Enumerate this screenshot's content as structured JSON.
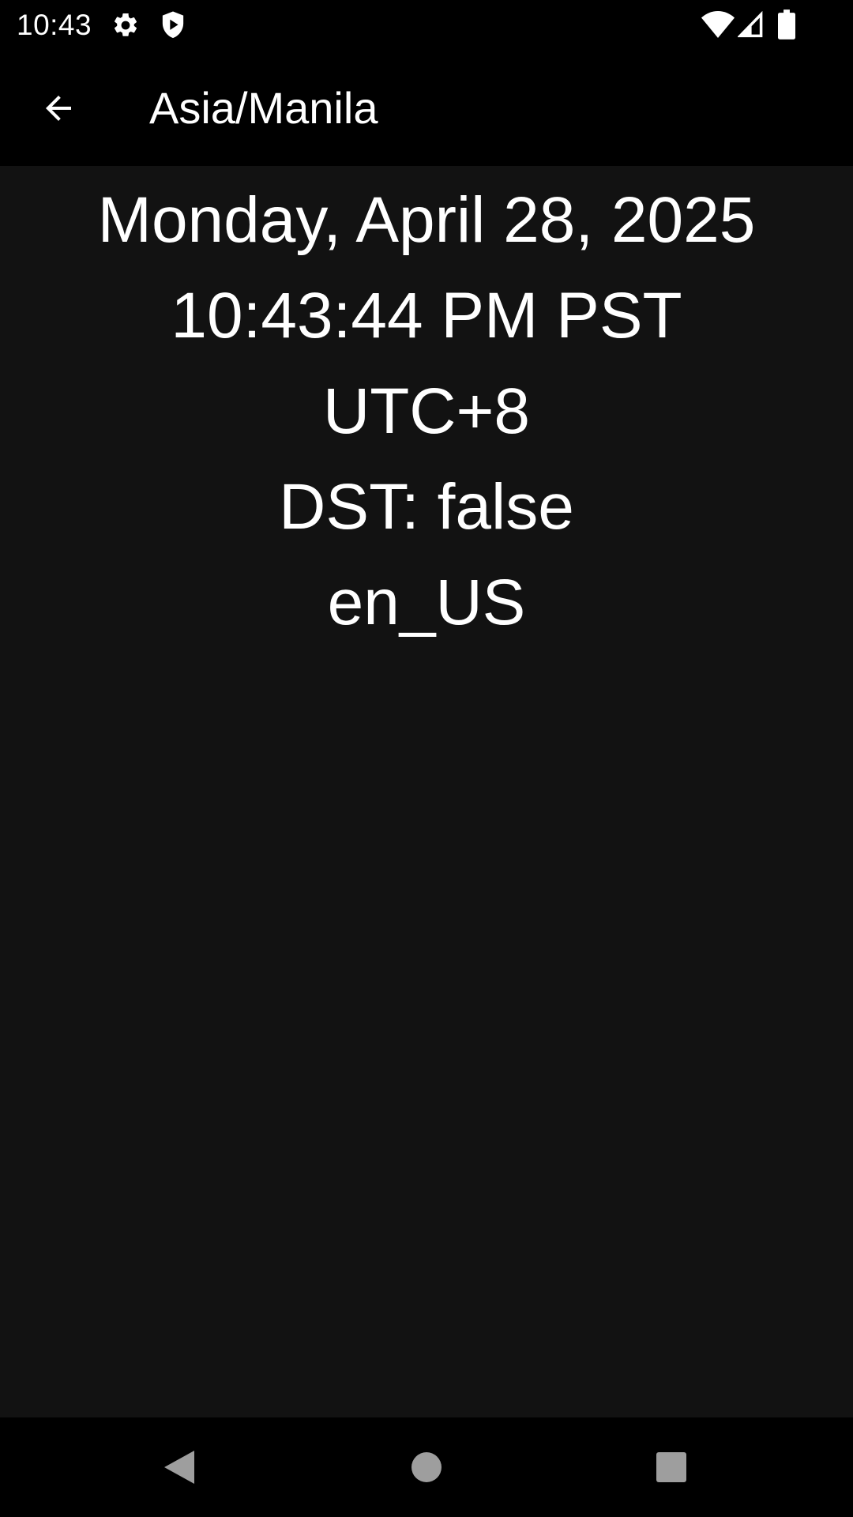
{
  "status_bar": {
    "time": "10:43",
    "left_icons": [
      "gear-icon",
      "shield-play-icon"
    ],
    "right_icons": [
      "wifi-icon",
      "cell-signal-icon",
      "battery-icon"
    ]
  },
  "app_bar": {
    "title": "Asia/Manila",
    "back_icon": "arrow-left-icon"
  },
  "details": {
    "date": "Monday, April 28, 2025",
    "time": "10:43:44 PM PST",
    "utc_offset": "UTC+8",
    "dst": "DST: false",
    "locale": "en_US"
  },
  "nav_bar": {
    "buttons": [
      "back-triangle-icon",
      "home-circle-icon",
      "recents-square-icon"
    ]
  },
  "colors": {
    "background": "#121212",
    "bars": "#000000",
    "text": "#ffffff",
    "nav_icon": "#9e9e9e"
  }
}
